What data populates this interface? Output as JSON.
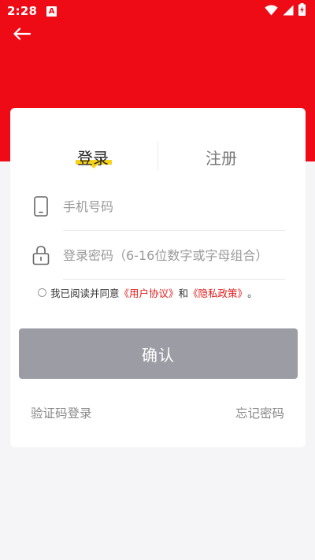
{
  "status_bar": {
    "time": "2:28",
    "notification_badge": "A",
    "icons": [
      "wifi-icon",
      "signal-icon",
      "battery-charging-icon"
    ]
  },
  "header": {
    "back_icon": "arrow-left-icon",
    "background_color": "#ee0b16"
  },
  "tabs": {
    "login": "登录",
    "register": "注册",
    "active_tab": "login",
    "active_underline_color": "#f6d21a"
  },
  "form": {
    "phone": {
      "icon": "phone-icon",
      "value": "",
      "placeholder": "手机号码"
    },
    "password": {
      "icon": "lock-icon",
      "value": "",
      "placeholder": "登录密码（6-16位数字或字母组合）"
    }
  },
  "agreement": {
    "checked": false,
    "prefix": "我已阅读并同意",
    "user_agreement": "《用户协议》",
    "conjunction": "和",
    "privacy_policy": "《隐私政策》",
    "suffix": "。",
    "link_color": "#e21a1a"
  },
  "confirm_button": {
    "label": "确认",
    "color": "#9b9ca4"
  },
  "bottom_links": {
    "sms_login": "验证码登录",
    "forgot_password": "忘记密码"
  }
}
